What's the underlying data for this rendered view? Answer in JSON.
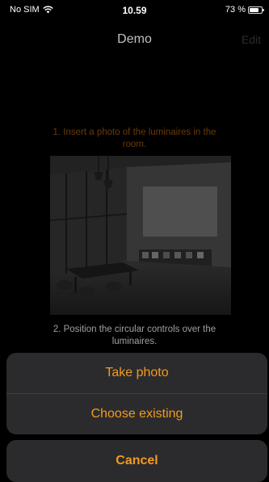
{
  "status": {
    "carrier": "No SIM",
    "time": "10.59",
    "battery_text": "73 %"
  },
  "nav": {
    "title": "Demo",
    "edit_label": "Edit"
  },
  "content": {
    "instruction_1": "1. Insert a photo of the luminaires in the room.",
    "instruction_2": "2. Position the circular controls over the luminaires."
  },
  "action_sheet": {
    "take_photo": "Take photo",
    "choose_existing": "Choose existing",
    "cancel": "Cancel"
  },
  "colors": {
    "accent": "#f39a1e",
    "instruction_accent": "#8a4e10",
    "sheet_bg": "#2b2b2d"
  }
}
